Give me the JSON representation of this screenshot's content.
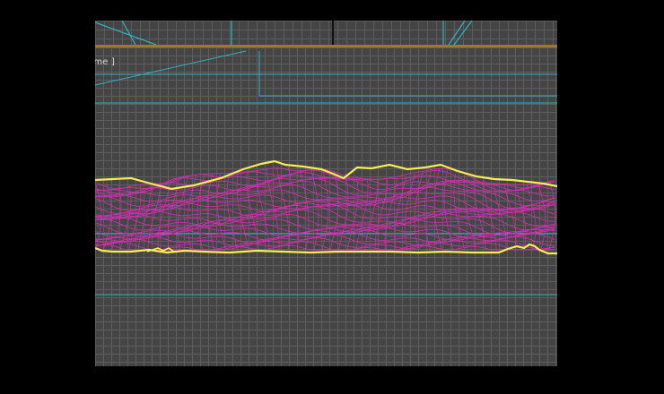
{
  "viewport": {
    "label": "ame ]"
  },
  "colors": {
    "background": "#000000",
    "grid_fill": "#454545",
    "grid_line": "#5e5e5e",
    "active_border": "#a0782c",
    "guide_cyan": "#2fb4c8",
    "outline_yellow": "#f4ee50",
    "mesh_magenta": "#d22fb4"
  },
  "icons": {
    "terrain_mesh": "terrain-mesh-icon",
    "boundary_spline": "boundary-spline-icon"
  }
}
